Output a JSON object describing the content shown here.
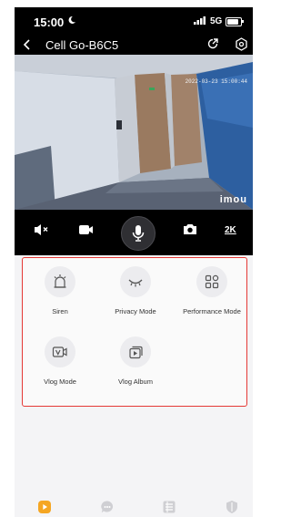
{
  "status_bar": {
    "time": "15:00",
    "network": "5G",
    "icons": [
      "moon-icon",
      "signal-icon",
      "battery-icon"
    ]
  },
  "header": {
    "title": "Cell Go-B6C5",
    "icons": [
      "back-icon",
      "share-icon",
      "settings-icon"
    ]
  },
  "video": {
    "timestamp": "2022-03-23 15:00:44",
    "watermark": "imou"
  },
  "controls": {
    "icons": [
      "mute-icon",
      "record-icon",
      "microphone-icon",
      "camera-icon"
    ],
    "resolution": "2K"
  },
  "features": [
    {
      "label": "Siren",
      "icon": "siren-icon"
    },
    {
      "label": "Privacy Mode",
      "icon": "eye-closed-icon"
    },
    {
      "label": "Performance Mode",
      "icon": "grid-icon"
    },
    {
      "label": "Vlog Mode",
      "icon": "vlog-icon"
    },
    {
      "label": "Vlog Album",
      "icon": "album-icon"
    }
  ],
  "bottom_nav": {
    "icons": [
      "play-icon",
      "chat-icon",
      "list-icon",
      "shield-icon"
    ],
    "active_color": "#f5a623"
  },
  "colors": {
    "accent": "#f5a623",
    "highlight_border": "#e53935"
  }
}
